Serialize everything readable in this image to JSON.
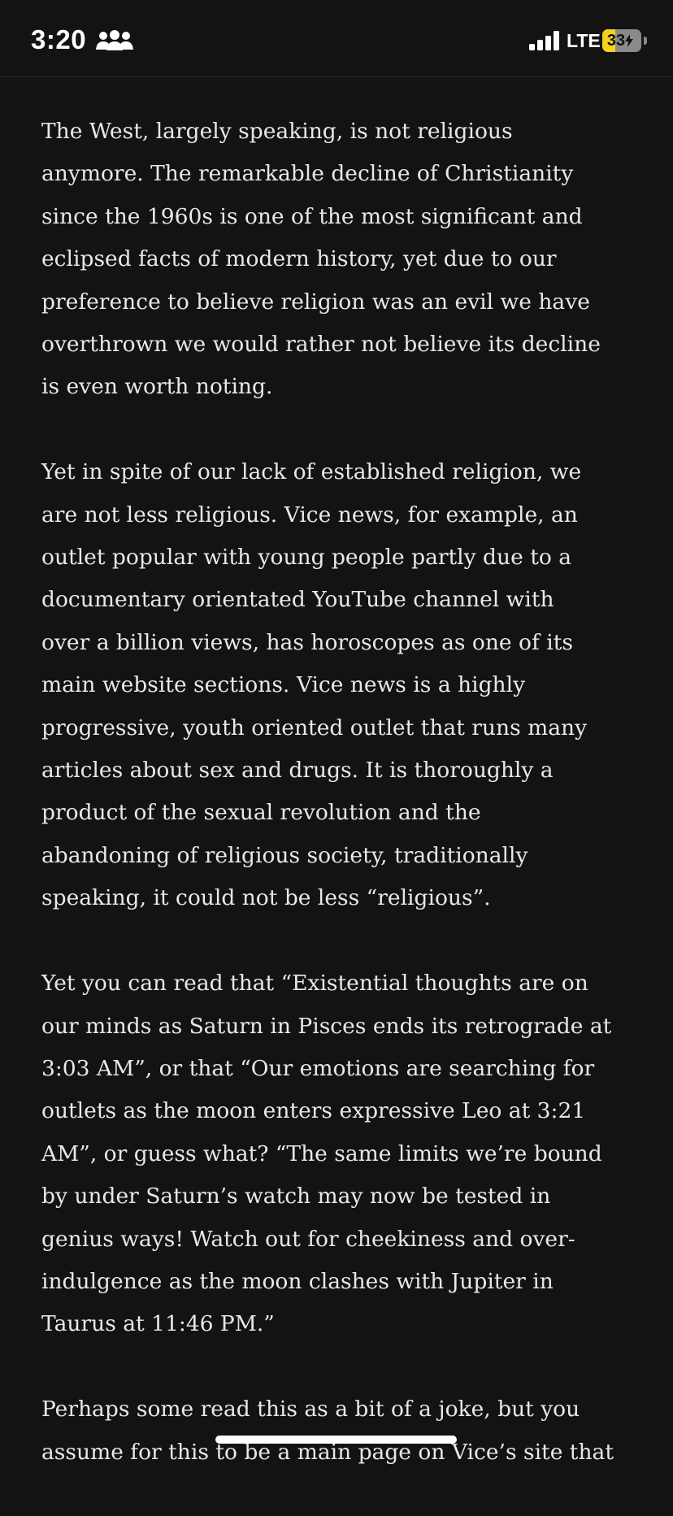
{
  "status_bar": {
    "time": "3:20",
    "network": "LTE",
    "battery_text": "33",
    "battery_level": 0.33,
    "battery_color": "#f3d21c",
    "icons": [
      "people-icon",
      "signal-icon",
      "battery-icon",
      "charging-bolt-icon"
    ]
  },
  "article": {
    "paragraphs": [
      "The West, largely speaking, is not religious\nanymore. The remarkable decline of Christianity\nsince the 1960s is one of the most significant and\neclipsed facts of modern history, yet due to our\npreference to believe religion was an evil we have\noverthrown we would rather not believe its decline\nis even worth noting.",
      "Yet in spite of our lack of established religion, we\nare not less religious. Vice news, for example, an\noutlet popular with young people partly due to a\ndocumentary orientated YouTube channel with\nover a billion views, has horoscopes as one of its\nmain website sections. Vice news is a highly\nprogressive, youth oriented outlet that runs many\narticles about sex and drugs. It is thoroughly a\nproduct of the sexual revolution and the\nabandoning of religious society, traditionally\nspeaking, it could not be less “religious”.",
      "Yet you can read that “Existential thoughts are on\nour minds as Saturn in Pisces ends its retrograde at\n3:03 AM”, or that “Our emotions are searching for\noutlets as the moon enters expressive Leo at 3:21\nAM”, or guess what? “The same limits we’re bound\nby under Saturn’s watch may now be tested in\ngenius ways! Watch out for cheekiness and over-\nindulgence as the moon clashes with Jupiter in\nTaurus at 11:46 PM.”",
      "Perhaps some read this as a bit of a joke, but you\nassume for this to be a main page on Vice’s site that"
    ]
  },
  "colors": {
    "background": "#131313",
    "text": "#e8e8e8",
    "status_text": "#ffffff"
  }
}
